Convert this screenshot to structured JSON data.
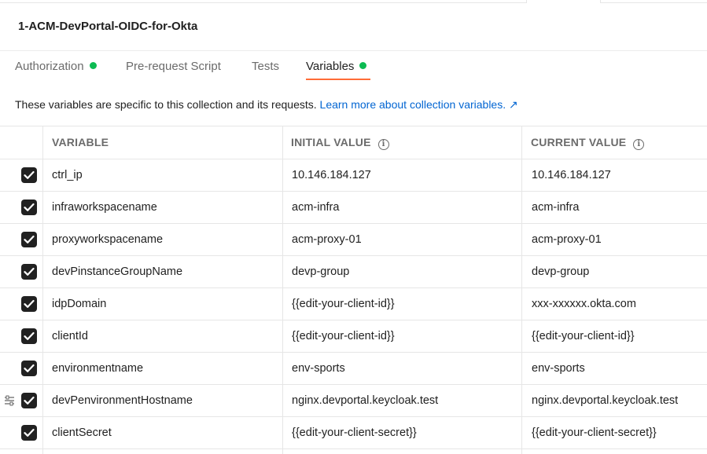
{
  "collection": {
    "title": "1-ACM-DevPortal-OIDC-for-Okta"
  },
  "tabs": [
    {
      "label": "Authorization",
      "indicator": true
    },
    {
      "label": "Pre-request Script",
      "indicator": false
    },
    {
      "label": "Tests",
      "indicator": false
    },
    {
      "label": "Variables",
      "indicator": true,
      "active": true
    }
  ],
  "description": {
    "text": "These variables are specific to this collection and its requests.",
    "link": "Learn more about collection variables. ↗"
  },
  "table": {
    "headers": {
      "variable": "VARIABLE",
      "initial": "INITIAL VALUE",
      "current": "CURRENT VALUE"
    },
    "rows": [
      {
        "checked": true,
        "variable": "ctrl_ip",
        "initial": "10.146.184.127",
        "current": "10.146.184.127"
      },
      {
        "checked": true,
        "variable": "infraworkspacename",
        "initial": "acm-infra",
        "current": "acm-infra"
      },
      {
        "checked": true,
        "variable": "proxyworkspacename",
        "initial": "acm-proxy-01",
        "current": "acm-proxy-01"
      },
      {
        "checked": true,
        "variable": "devPinstanceGroupName",
        "initial": "devp-group",
        "current": "devp-group"
      },
      {
        "checked": true,
        "variable": "idpDomain",
        "initial": "{{edit-your-client-id}}",
        "current": "xxx-xxxxxx.okta.com"
      },
      {
        "checked": true,
        "variable": "clientId",
        "initial": "{{edit-your-client-id}}",
        "current": "{{edit-your-client-id}}"
      },
      {
        "checked": true,
        "variable": "environmentname",
        "initial": "env-sports",
        "current": "env-sports"
      },
      {
        "checked": true,
        "variable": "devPenvironmentHostname",
        "initial": "nginx.devportal.keycloak.test",
        "current": "nginx.devportal.keycloak.test"
      },
      {
        "checked": true,
        "variable": "clientSecret",
        "initial": "{{edit-your-client-secret}}",
        "current": "{{edit-your-client-secret}}"
      }
    ]
  },
  "colors": {
    "accent_underline": "#ff6c37",
    "indicator_dot": "#0cbb52",
    "link": "#0265d2"
  },
  "icons": {
    "info": "info-circle-icon",
    "checkbox": "check-icon",
    "drag": "drag-handle-icon"
  }
}
